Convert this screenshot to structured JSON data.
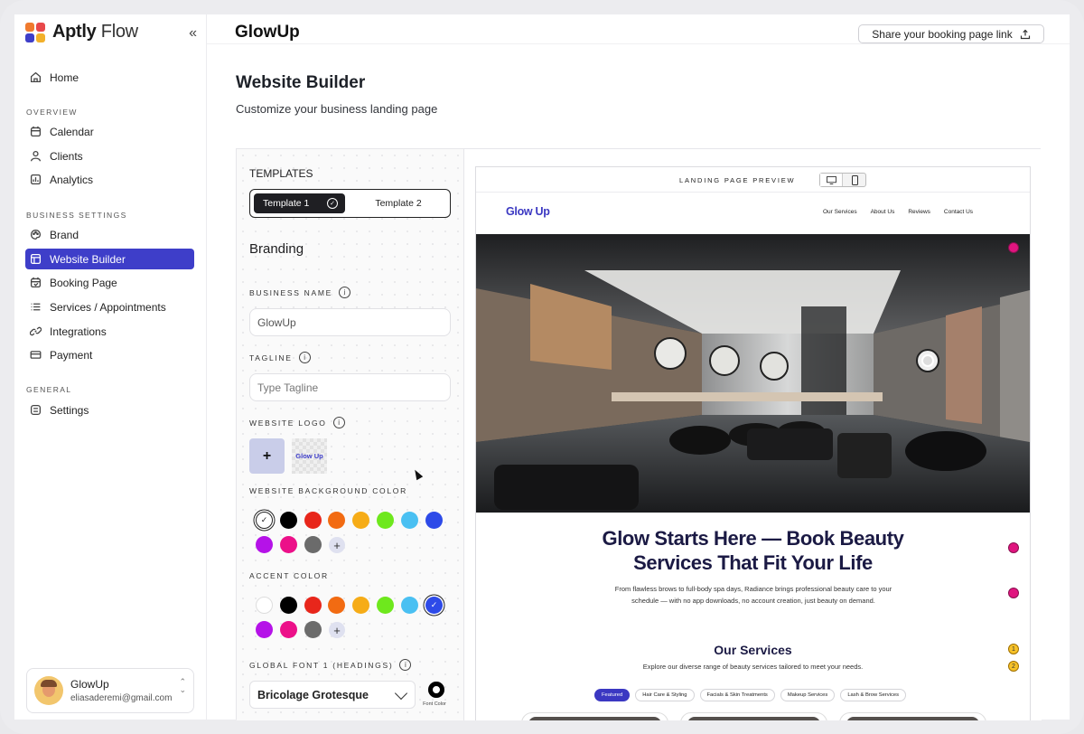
{
  "app": {
    "brand_bold": "Aptly",
    "brand_light": "Flow",
    "collapse_glyph": "«"
  },
  "nav": {
    "home": "Home",
    "overview_label": "OVERVIEW",
    "calendar": "Calendar",
    "clients": "Clients",
    "analytics": "Analytics",
    "business_label": "BUSINESS SETTINGS",
    "brand": "Brand",
    "website_builder": "Website Builder",
    "booking_page": "Booking Page",
    "services": "Services / Appointments",
    "integrations": "Integrations",
    "payment": "Payment",
    "general_label": "GENERAL",
    "settings": "Settings"
  },
  "user": {
    "name": "GlowUp",
    "email": "eliasaderemi@gmail.com"
  },
  "header": {
    "title": "GlowUp",
    "share_label": "Share your booking page link"
  },
  "page": {
    "title": "Website Builder",
    "subtitle": "Customize your business landing page"
  },
  "panel": {
    "templates_label": "TEMPLATES",
    "template_1": "Template 1",
    "template_2": "Template 2",
    "branding_label": "Branding",
    "business_name_label": "BUSINESS NAME",
    "business_name_value": "GlowUp",
    "tagline_label": "TAGLINE",
    "tagline_placeholder": "Type Tagline",
    "logo_label": "WEBSITE LOGO",
    "logo_add": "+",
    "logo_thumb_text": "Glow Up",
    "bg_color_label": "WEBSITE BACKGROUND COLOR",
    "accent_label": "ACCENT COLOR",
    "font_label": "GLOBAL FONT 1 (HEADINGS)",
    "font_value": "Bricolage Grotesque",
    "font_color_label": "Font Color",
    "swatch_add": "+",
    "info_glyph": "i"
  },
  "colors": {
    "brand_accent": "#3e3ec9",
    "palette": [
      "#ffffff",
      "#000000",
      "#e8261b",
      "#f26b12",
      "#f6ac17",
      "#6ee81d",
      "#4ac0f2",
      "#2d4ae8",
      "#b512e8",
      "#ec1089",
      "#6b6b6b"
    ],
    "bg_selected": "#ffffff",
    "accent_selected": "#2d4ae8"
  },
  "preview": {
    "header_label": "LANDING PAGE PREVIEW",
    "site_name": "Glow Up",
    "nav_links": [
      "Our Services",
      "About Us",
      "Reviews",
      "Contact Us"
    ],
    "headline_1": "Glow Starts Here — Book Beauty",
    "headline_2": "Services That Fit Your Life",
    "description_1": "From flawless brows to full-body spa days, Radiance brings professional beauty care to your",
    "description_2": "schedule — with no app downloads, no account creation, just beauty on demand.",
    "services_title": "Our Services",
    "services_sub": "Explore our diverse range of beauty services tailored to meet your needs.",
    "chips": [
      "Featured",
      "Hair Care & Styling",
      "Facials & Skin Treatments",
      "Makeup Services",
      "Lash & Brow Services"
    ],
    "markers": [
      "1",
      "2"
    ]
  }
}
